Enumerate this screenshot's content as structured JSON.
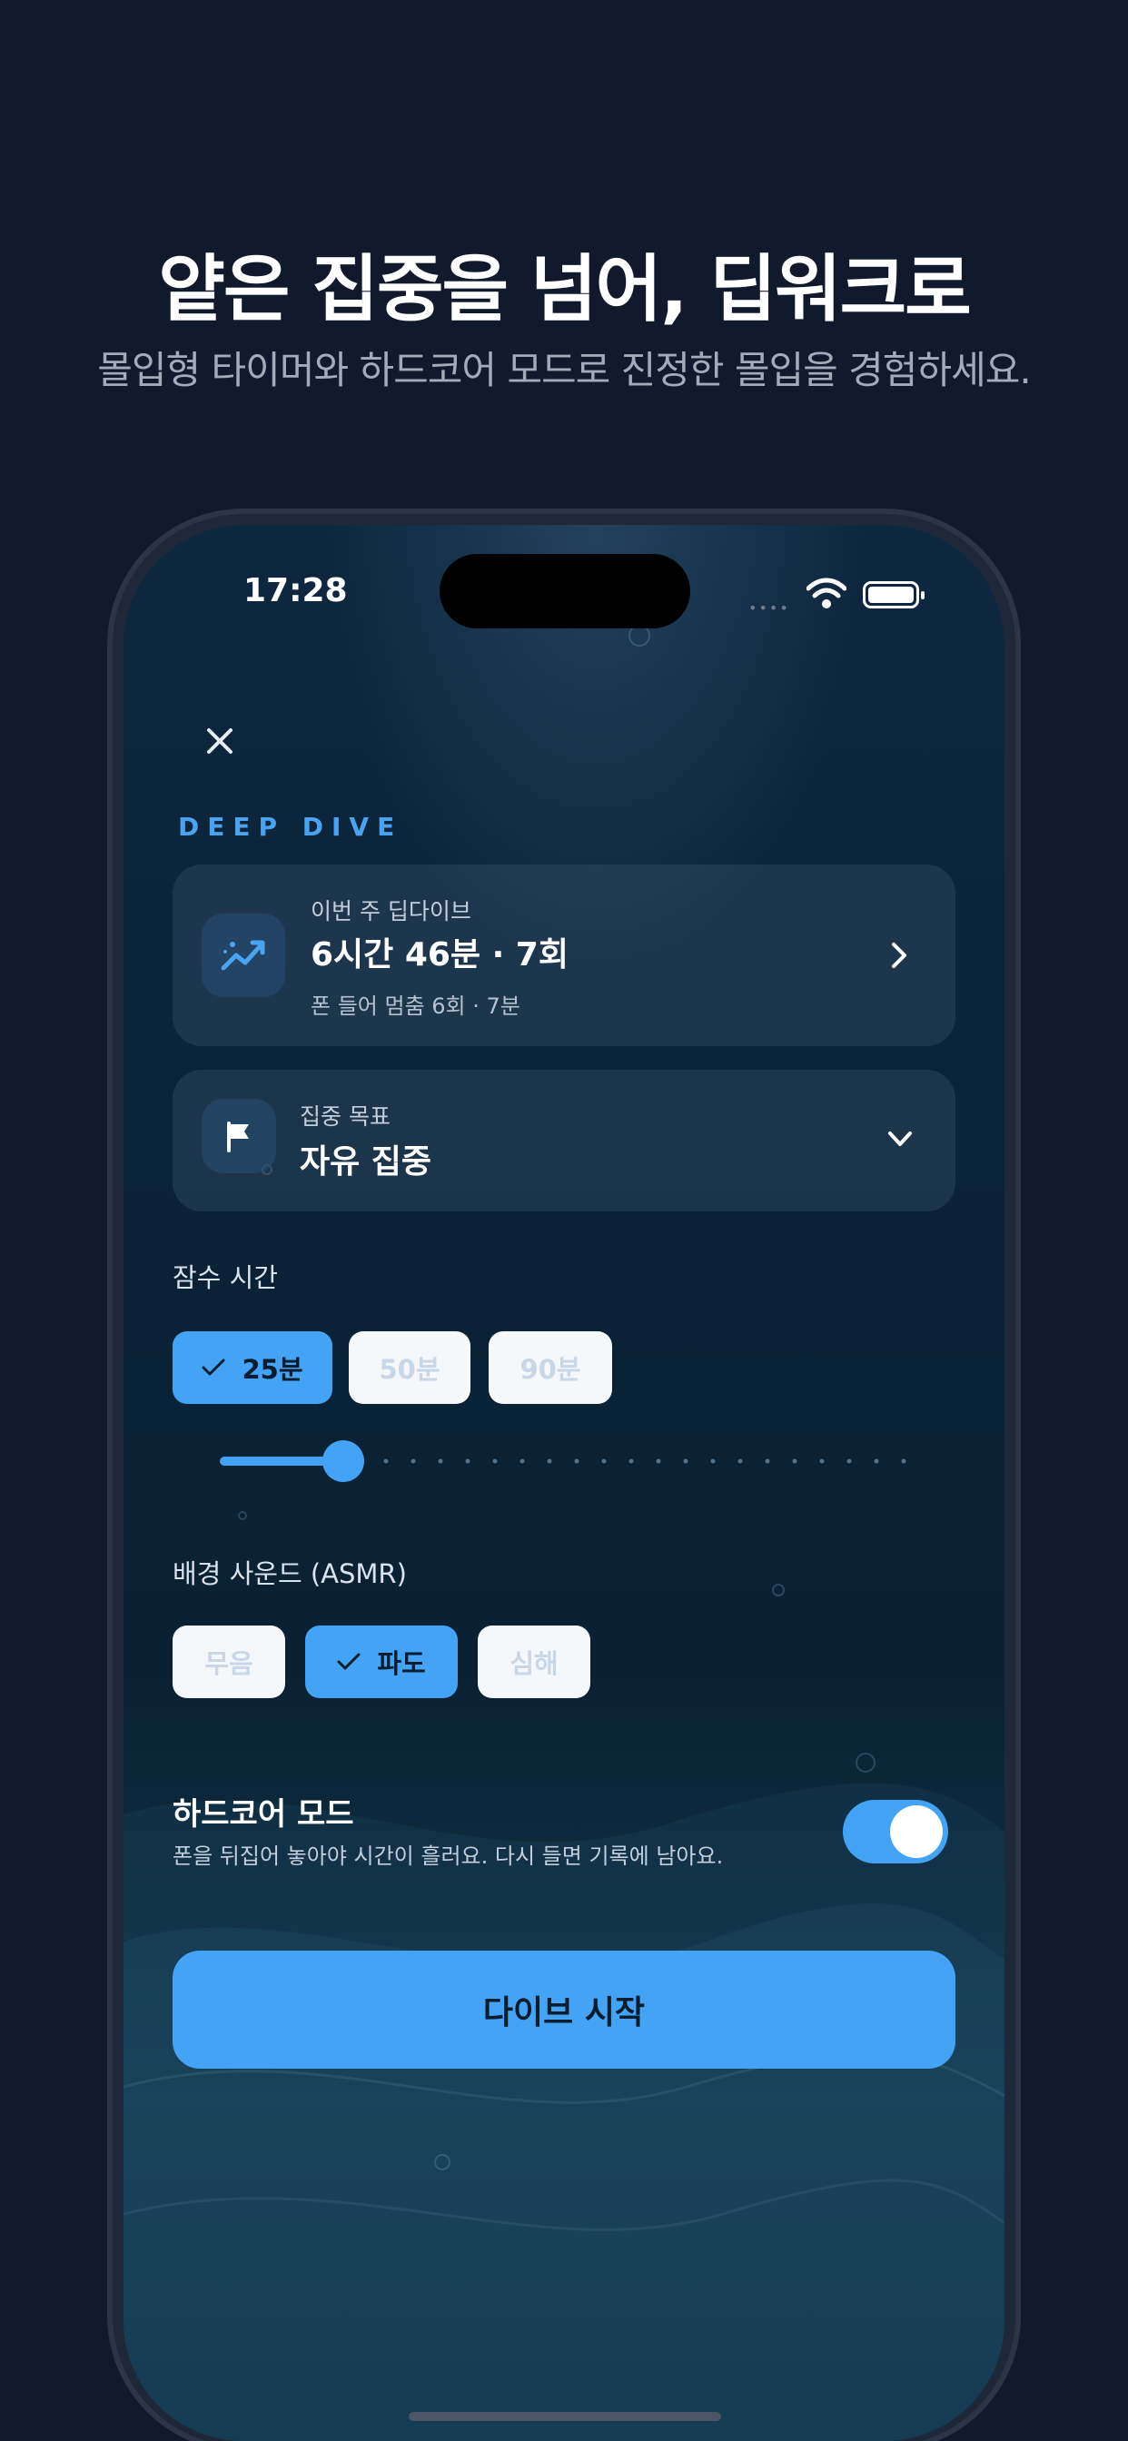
{
  "promo": {
    "title": "얕은 집중을 넘어, 딥워크로",
    "subtitle": "몰입형 타이머와 하드코어 모드로 진정한 몰입을 경험하세요."
  },
  "status_bar": {
    "time": "17:28",
    "signal": "••••"
  },
  "screen": {
    "section_eyebrow": "DEEP DIVE",
    "weekly_card": {
      "icon": "trending-up-icon",
      "label": "이번 주 딥다이브",
      "value": "6시간 46분 · 7회",
      "sub": "폰 들어 멈춤 6회 · 7분"
    },
    "goal_card": {
      "icon": "flag-icon",
      "label": "집중 목표",
      "value": "자유 집중"
    },
    "dive_time": {
      "label": "잠수 시간",
      "options": [
        "25분",
        "50분",
        "90분"
      ],
      "selected_index": 0,
      "slider_fraction": 0.18
    },
    "sound": {
      "label": "배경 사운드 (ASMR)",
      "options": [
        "무음",
        "파도",
        "심해"
      ],
      "selected_index": 1
    },
    "hardcore": {
      "title": "하드코어 모드",
      "description": "폰을 뒤집어 놓아야 시간이 흘러요. 다시 들면 기록에 남아요.",
      "enabled": true
    },
    "start_button": "다이브 시작"
  },
  "colors": {
    "accent": "#44a3f5",
    "background": "#111a2c"
  }
}
